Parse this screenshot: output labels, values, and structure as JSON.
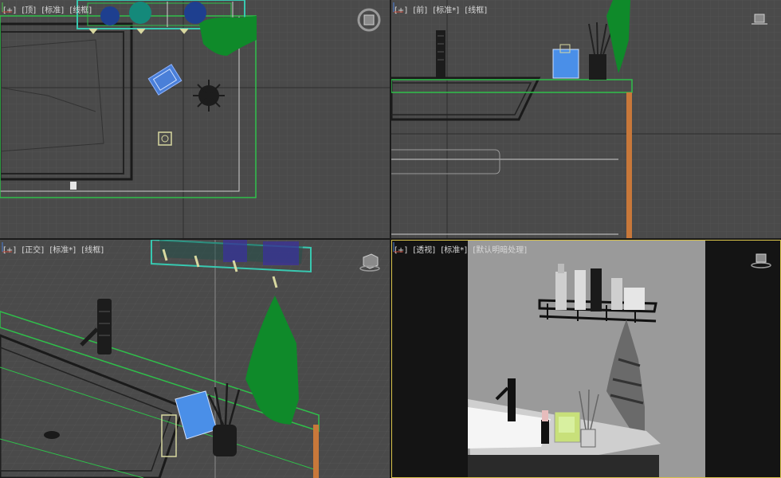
{
  "viewports": [
    {
      "id": "top",
      "labels": [
        "[+]",
        "[顶]",
        "[标准]",
        "[线框]"
      ]
    },
    {
      "id": "front",
      "labels": [
        "[+]",
        "[前]",
        "[标准*]",
        "[线框]"
      ]
    },
    {
      "id": "ortho",
      "labels": [
        "[+]",
        "[正交]",
        "[标准*]",
        "[线框]"
      ]
    },
    {
      "id": "perspective",
      "labels": [
        "[+]",
        "[透视]",
        "[标准*]",
        "[默认明暗处理]"
      ]
    }
  ],
  "colors": {
    "grid_bg": "#4a4a4a",
    "grid_line": "#555555",
    "grid_major": "#3c3c3c",
    "active_border": "#d8c24a",
    "render_bg": "#9a9a9a",
    "wire_green": "#2fbf4a",
    "wire_cyan": "#38c8b0",
    "wire_blue": "#4a7fd8",
    "wire_orange": "#d98b4a"
  },
  "icons": {
    "viewcube": "viewcube-icon",
    "axis": "axis-tripod-icon"
  }
}
